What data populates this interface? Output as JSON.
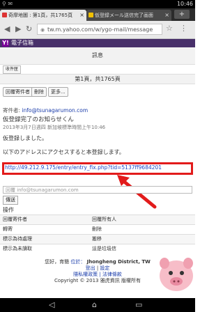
{
  "status_bar": {
    "time": "10:46"
  },
  "tabs": [
    {
      "label": "奇摩地圖 : 第1頁，共1765頁"
    },
    {
      "label": "仮登録メール送信完了画面"
    }
  ],
  "address_bar": {
    "url": "tw.m.yahoo.com/w/ygo-mail/message"
  },
  "header": {
    "logo": "Y!",
    "title": "電子信箱"
  },
  "message_title": "訊息",
  "inbox_button": "收件匣",
  "pager": "第1頁，共1765頁",
  "actions": {
    "reply": "回覆寄件者",
    "delete": "刪除",
    "more": "更多..."
  },
  "sender": {
    "label": "寄件者:",
    "email": "info@tsunagarumon.com"
  },
  "subject": "仮登録完了のお知らせくん",
  "date": "2013年3月7日週四 新加坡標準時間上午10:46",
  "body": {
    "line1": "仮登録しました。",
    "line2": "以下のアドレスにアクセスすると本登録します。",
    "link": "http://49.212.9.175/entry/entry_fix.php?tid=5137ff9684201"
  },
  "quick_reply": {
    "placeholder": "回覆 info@tsunagarumon.com",
    "send": "傳送"
  },
  "operations": {
    "label": "操作",
    "rows": [
      [
        "回覆寄件者",
        "回覆所有人"
      ],
      [
        "轉寄",
        "刪除"
      ],
      [
        "標示為待處理",
        "搬移"
      ],
      [
        "標示為未讀取",
        "這是垃圾信"
      ]
    ]
  },
  "footer": {
    "line1_prefix": "您好，育簡",
    "location_label": "位於：",
    "location": "Jhongheng District, TW",
    "line2a": "登出",
    "line2b": "設定",
    "line3": "隱私權政策 | 法律條款",
    "copyright": "Copyright © 2013 雅虎資訊 版權所有"
  },
  "colors": {
    "highlight": "#e21b1b",
    "header": "#48306a",
    "link": "#1f45c5"
  }
}
